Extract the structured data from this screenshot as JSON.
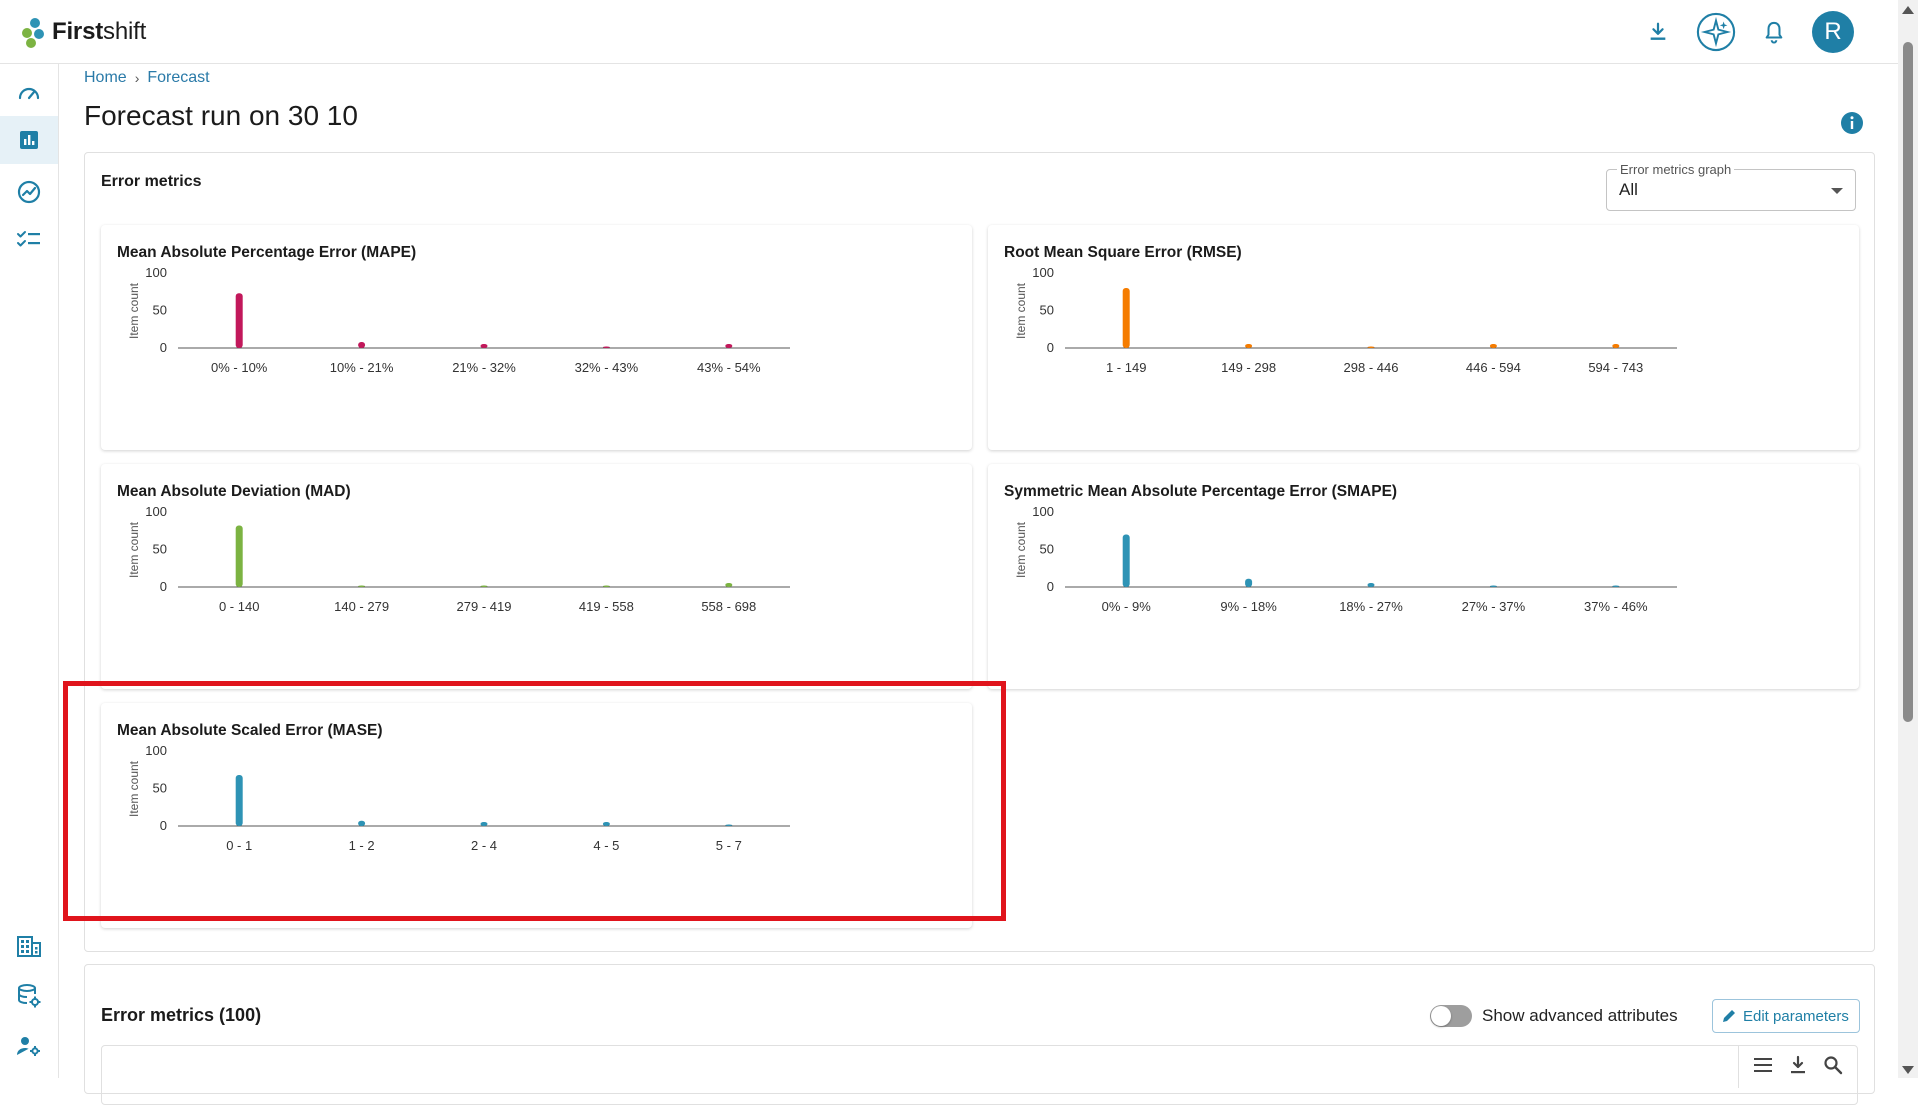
{
  "app": {
    "brand_bold": "First",
    "brand_light": "shift",
    "avatar_initial": "R",
    "accent_color": "#1f7fa6"
  },
  "top_icons": [
    "download-icon",
    "ai-sparkle-icon",
    "bell-icon"
  ],
  "sidebar": {
    "items": [
      "dashboard-icon",
      "bar-chart-icon",
      "trend-icon",
      "checklist-icon",
      "building-icon",
      "database-settings-icon",
      "user-settings-icon"
    ],
    "active_index": 1
  },
  "breadcrumb": {
    "home": "Home",
    "sep": "›",
    "current": "Forecast"
  },
  "page": {
    "title": "Forecast run on 30 10"
  },
  "error_metrics_panel": {
    "title": "Error metrics",
    "select": {
      "label": "Error metrics graph",
      "value": "All"
    }
  },
  "chart_data": [
    {
      "type": "bar",
      "title": "Mean Absolute Percentage Error (MAPE)",
      "ylabel": "Item count",
      "ylim": [
        0,
        100
      ],
      "yticks": [
        "100",
        "50",
        "0"
      ],
      "categories": [
        "0% - 10%",
        "10% - 21%",
        "21% - 32%",
        "32% - 43%",
        "43% - 54%"
      ],
      "values": [
        73,
        8,
        3,
        0,
        1
      ],
      "color": "#c2185b"
    },
    {
      "type": "bar",
      "title": "Root Mean Square Error (RMSE)",
      "ylabel": "Item count",
      "ylim": [
        0,
        100
      ],
      "yticks": [
        "100",
        "50",
        "0"
      ],
      "categories": [
        "1 - 149",
        "149 - 298",
        "298 - 446",
        "446 - 594",
        "594 - 743"
      ],
      "values": [
        80,
        3,
        0,
        1,
        1
      ],
      "color": "#f57c00"
    },
    {
      "type": "bar",
      "title": "Mean Absolute Deviation (MAD)",
      "ylabel": "Item count",
      "ylim": [
        0,
        100
      ],
      "yticks": [
        "100",
        "50",
        "0"
      ],
      "categories": [
        "0 - 140",
        "140 - 279",
        "279 - 419",
        "419 - 558",
        "558 - 698"
      ],
      "values": [
        82,
        0,
        0,
        0,
        1
      ],
      "color": "#7cb342"
    },
    {
      "type": "bar",
      "title": "Symmetric Mean Absolute Percentage Error (SMAPE)",
      "ylabel": "Item count",
      "ylim": [
        0,
        100
      ],
      "yticks": [
        "100",
        "50",
        "0"
      ],
      "categories": [
        "0% - 9%",
        "9% - 18%",
        "18% - 27%",
        "27% - 37%",
        "37% - 46%"
      ],
      "values": [
        70,
        11,
        2,
        0,
        0
      ],
      "color": "#2e93b5"
    },
    {
      "type": "bar",
      "title": "Mean Absolute Scaled Error (MASE)",
      "ylabel": "Item count",
      "ylim": [
        0,
        100
      ],
      "yticks": [
        "100",
        "50",
        "0"
      ],
      "categories": [
        "0 - 1",
        "1 - 2",
        "2 - 4",
        "4 - 5",
        "5 - 7"
      ],
      "values": [
        68,
        7,
        4,
        3,
        0
      ],
      "color": "#2e93b5"
    }
  ],
  "error_table_panel": {
    "title": "Error metrics (100)",
    "toggle_label": "Show advanced attributes",
    "toggle_on": false,
    "edit_button": "Edit parameters",
    "grid_tools": [
      "columns-icon",
      "download-icon",
      "search-icon"
    ]
  }
}
